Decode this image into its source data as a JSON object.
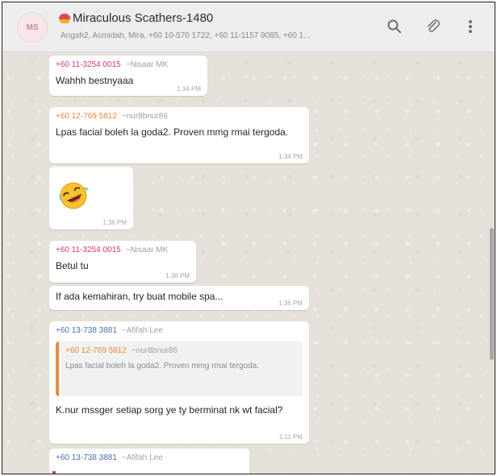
{
  "header": {
    "title": "Miraculous Scathers-1480",
    "participants": "Angah2, Asmidah, Mira, +60 10-570 1722, +60 11-1157 9085, +60 1...",
    "avatar_text": "MS",
    "icons": [
      "search-icon",
      "paperclip-icon",
      "kebab-menu-icon"
    ]
  },
  "messages": [
    {
      "number": "+60 11-3254 0015",
      "nick": "~Nisaar MK",
      "text": "Wahhh bestnyaaa",
      "time": "1:34 PM"
    },
    {
      "number": "+60 12-769 5812",
      "nick": "~nur8bnur86",
      "text": "Lpas facial boleh la goda2. Proven mmg rmai tergoda.",
      "time": "1:34 PM"
    },
    {
      "emoji": "rofl-emoji",
      "time": "1:36 PM"
    },
    {
      "number": "+60 11-3254 0015",
      "nick": "~Nisaar MK",
      "text": "Betul tu",
      "time": "1:36 PM"
    },
    {
      "text": "If ada kemahiran, try buat mobile spa...",
      "time": "1:36 PM"
    },
    {
      "number": "+60 13-738 3881",
      "nick": "~Afifah Lee",
      "quote": {
        "number": "+60 12-769 5812",
        "nick": "~nur8bnur86",
        "text": "Lpas facial boleh la goda2. Proven mmg rmai tergoda."
      },
      "text": "K.nur mssger setiap sorg ye ty berminat nk wt facial?",
      "time": "1:11 PM"
    },
    {
      "number": "+60 13-738 3881",
      "nick": "~Afifah Lee"
    }
  ],
  "colors": {
    "pink": "#d3387a",
    "orange": "#e58b3a",
    "blue": "#4a6fb0",
    "header_bg": "#ededed",
    "chat_bg": "#e6e1d8"
  }
}
